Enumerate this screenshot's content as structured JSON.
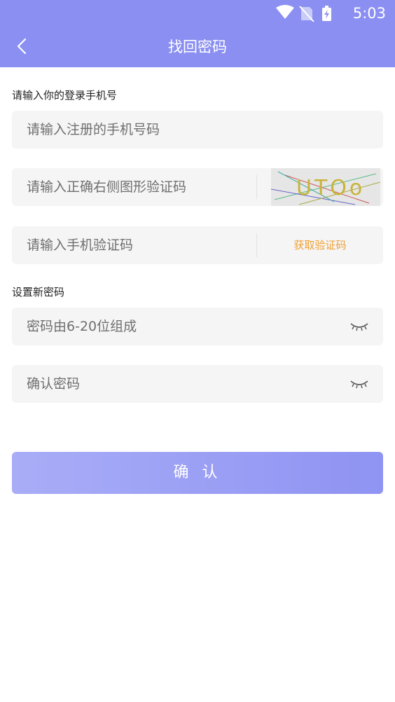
{
  "status_bar": {
    "time": "5:03"
  },
  "header": {
    "title": "找回密码"
  },
  "labels": {
    "phone_section": "请输入你的登录手机号",
    "password_section": "设置新密码"
  },
  "inputs": {
    "phone": {
      "placeholder": "请输入注册的手机号码",
      "value": ""
    },
    "captcha": {
      "placeholder": "请输入正确右侧图形验证码",
      "value": ""
    },
    "sms_code": {
      "placeholder": "请输入手机验证码",
      "value": ""
    },
    "new_password": {
      "placeholder": "密码由6-20位组成",
      "value": ""
    },
    "confirm_password": {
      "placeholder": "确认密码",
      "value": ""
    }
  },
  "captcha_image": {
    "text": "UTOo"
  },
  "buttons": {
    "get_code": "获取验证码",
    "confirm": "确 认"
  },
  "colors": {
    "header": "#8b8ff2",
    "accent_orange": "#f0a033",
    "field_bg": "#f5f5f5"
  },
  "icons": [
    "wifi-icon",
    "no-sim-icon",
    "battery-charging-icon",
    "back-arrow-icon",
    "eye-closed-icon"
  ]
}
